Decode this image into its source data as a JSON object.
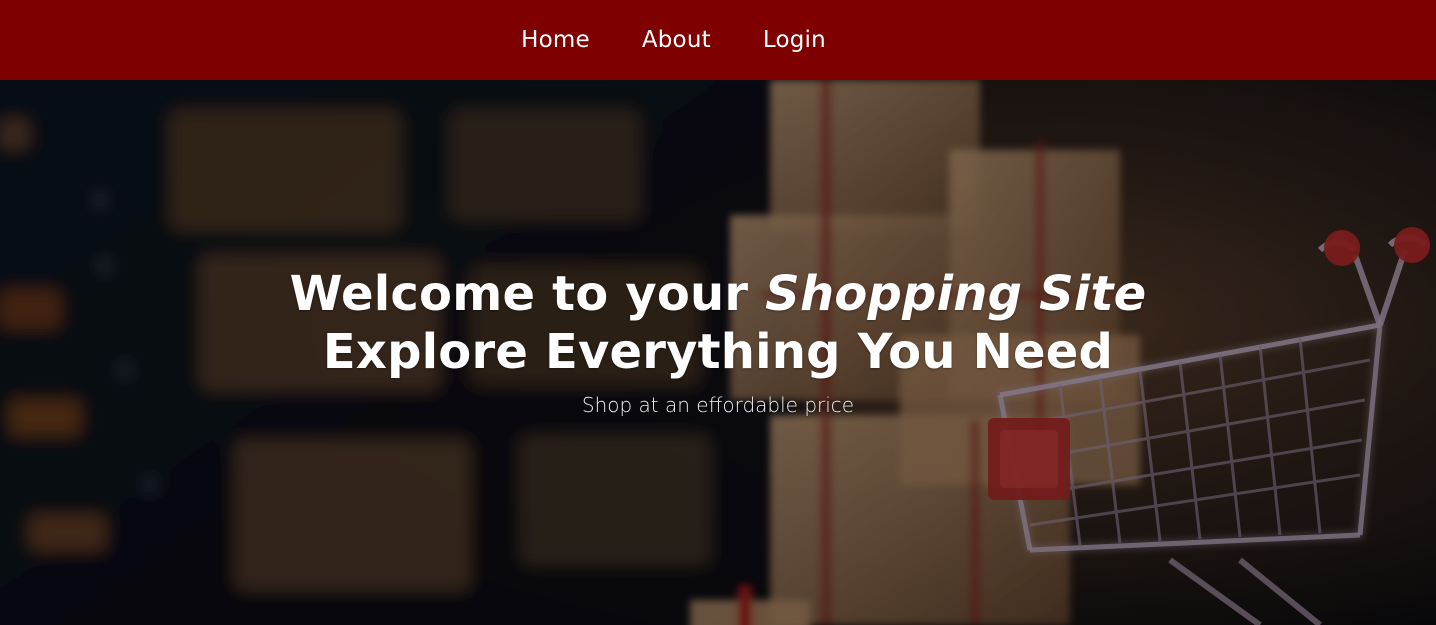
{
  "nav": {
    "items": [
      {
        "label": "Home"
      },
      {
        "label": "About"
      },
      {
        "label": "Login"
      }
    ]
  },
  "hero": {
    "title_prefix": "Welcome to your ",
    "title_emphasis": "Shopping Site",
    "title_line2": "Explore Everything You Need",
    "subtitle": "Shop at an effordable price"
  },
  "colors": {
    "navbar_bg": "#7f0000",
    "text": "#ffffff"
  }
}
